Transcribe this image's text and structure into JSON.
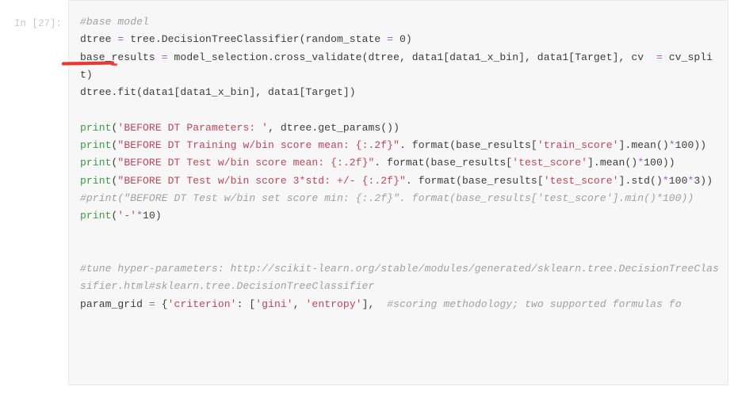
{
  "notebook": {
    "cell": {
      "prompt_label": "In [27]:",
      "cell_type": "code",
      "execution_count": 27
    },
    "annotation": {
      "kind": "red-underline",
      "target_text": "dtree",
      "color": "#e23b34"
    },
    "theme": {
      "cell_background": "#f7f7f7",
      "cell_border": "#e8e8e8",
      "page_background": "#ffffff",
      "prompt_color": "#c9c9c9",
      "text_color": "#3b3b3b",
      "comment_color": "#a0a0a0",
      "string_color": "#c5435a",
      "builtin_color": "#3a9a41",
      "operator_color": "#8f5fd6"
    },
    "source_lines": [
      {
        "id": "l1",
        "text": "#base model"
      },
      {
        "id": "l2",
        "text": "dtree = tree.DecisionTreeClassifier(random_state = 0)"
      },
      {
        "id": "l3",
        "text": "base_results = model_selection.cross_validate(dtree, data1[data1_x_bin], data1[Target], cv  = cv_split)"
      },
      {
        "id": "l4",
        "text": "dtree.fit(data1[data1_x_bin], data1[Target])"
      },
      {
        "id": "l5",
        "text": ""
      },
      {
        "id": "l6",
        "text": "print('BEFORE DT Parameters: ', dtree.get_params())"
      },
      {
        "id": "l7",
        "text": "print(\"BEFORE DT Training w/bin score mean: {:.2f}\". format(base_results['train_score'].mean()*100))"
      },
      {
        "id": "l8",
        "text": "print(\"BEFORE DT Test w/bin score mean: {:.2f}\". format(base_results['test_score'].mean()*100))"
      },
      {
        "id": "l9",
        "text": "print(\"BEFORE DT Test w/bin score 3*std: +/- {:.2f}\". format(base_results['test_score'].std()*100*3))"
      },
      {
        "id": "l10",
        "text": "#print(\"BEFORE DT Test w/bin set score min: {:.2f}\". format(base_results['test_score'].min()*100))"
      },
      {
        "id": "l11",
        "text": "print('-'*10)"
      },
      {
        "id": "l12",
        "text": ""
      },
      {
        "id": "l13",
        "text": ""
      },
      {
        "id": "l14",
        "text": "#tune hyper-parameters: http://scikit-learn.org/stable/modules/generated/sklearn.tree.DecisionTreeClassifier.html#sklearn.tree.DecisionTreeClassifier"
      },
      {
        "id": "l15",
        "text": "param_grid = {'criterion': ['gini', 'entropy'],  #scoring methodology; two supported formulas fo"
      }
    ],
    "tokens": {
      "line1_comment": "#base model",
      "line2_a": "dtree ",
      "line2_eq": "=",
      "line2_b": " tree.DecisionTreeClassifier(random_state ",
      "line2_eq2": "=",
      "line2_c": " 0)",
      "line3_a": "base_results ",
      "line3_eq": "=",
      "line3_b": " model_selection.cross_validate(dtree, data1[data1_x_bin], data1[Target], cv  ",
      "line3_eq2": "=",
      "line3_c": " cv_split)",
      "line4": "dtree.fit(data1[data1_x_bin], data1[Target])",
      "line6_print": "print",
      "line6_open": "(",
      "line6_str": "'BEFORE DT Parameters: '",
      "line6_rest": ", dtree.get_params())",
      "line7_print": "print",
      "line7_open": "(",
      "line7_str": "\"BEFORE DT Training w/bin score mean: {:.2f}\"",
      "line7_mid": ". format(base_results[",
      "line7_str2": "'train_score'",
      "line7_mid2": "].mean()",
      "line7_op": "*",
      "line7_end": "100))",
      "line8_print": "print",
      "line8_open": "(",
      "line8_str": "\"BEFORE DT Test w/bin score mean: {:.2f}\"",
      "line8_mid": ". format(base_results[",
      "line8_str2": "'test_score'",
      "line8_mid2": "].mean()",
      "line8_op": "*",
      "line8_end": "100))",
      "line9_print": "print",
      "line9_open": "(",
      "line9_str": "\"BEFORE DT Test w/bin score 3*std: +/- {:.2f}\"",
      "line9_mid": ". format(base_results[",
      "line9_str2": "'test_score'",
      "line9_mid2": "].std()",
      "line9_op": "*",
      "line9_mid3": "100",
      "line9_op2": "*",
      "line9_end": "3))",
      "line10_comment": "#print(\"BEFORE DT Test w/bin set score min: {:.2f}\". format(base_results['test_score'].min()*100))",
      "line11_print": "print",
      "line11_open": "(",
      "line11_str": "'-'",
      "line11_op": "*",
      "line11_end": "10)",
      "line14_comment": "#tune hyper-parameters: http://scikit-learn.org/stable/modules/generated/sklearn.tree.DecisionTreeClassifier.html#sklearn.tree.DecisionTreeClassifier",
      "line15_a": "param_grid ",
      "line15_eq": "=",
      "line15_b": " {",
      "line15_str1": "'criterion'",
      "line15_c": ": [",
      "line15_str2": "'gini'",
      "line15_d": ", ",
      "line15_str3": "'entropy'",
      "line15_e": "],  ",
      "line15_comment": "#scoring methodology; two supported formulas fo"
    }
  }
}
